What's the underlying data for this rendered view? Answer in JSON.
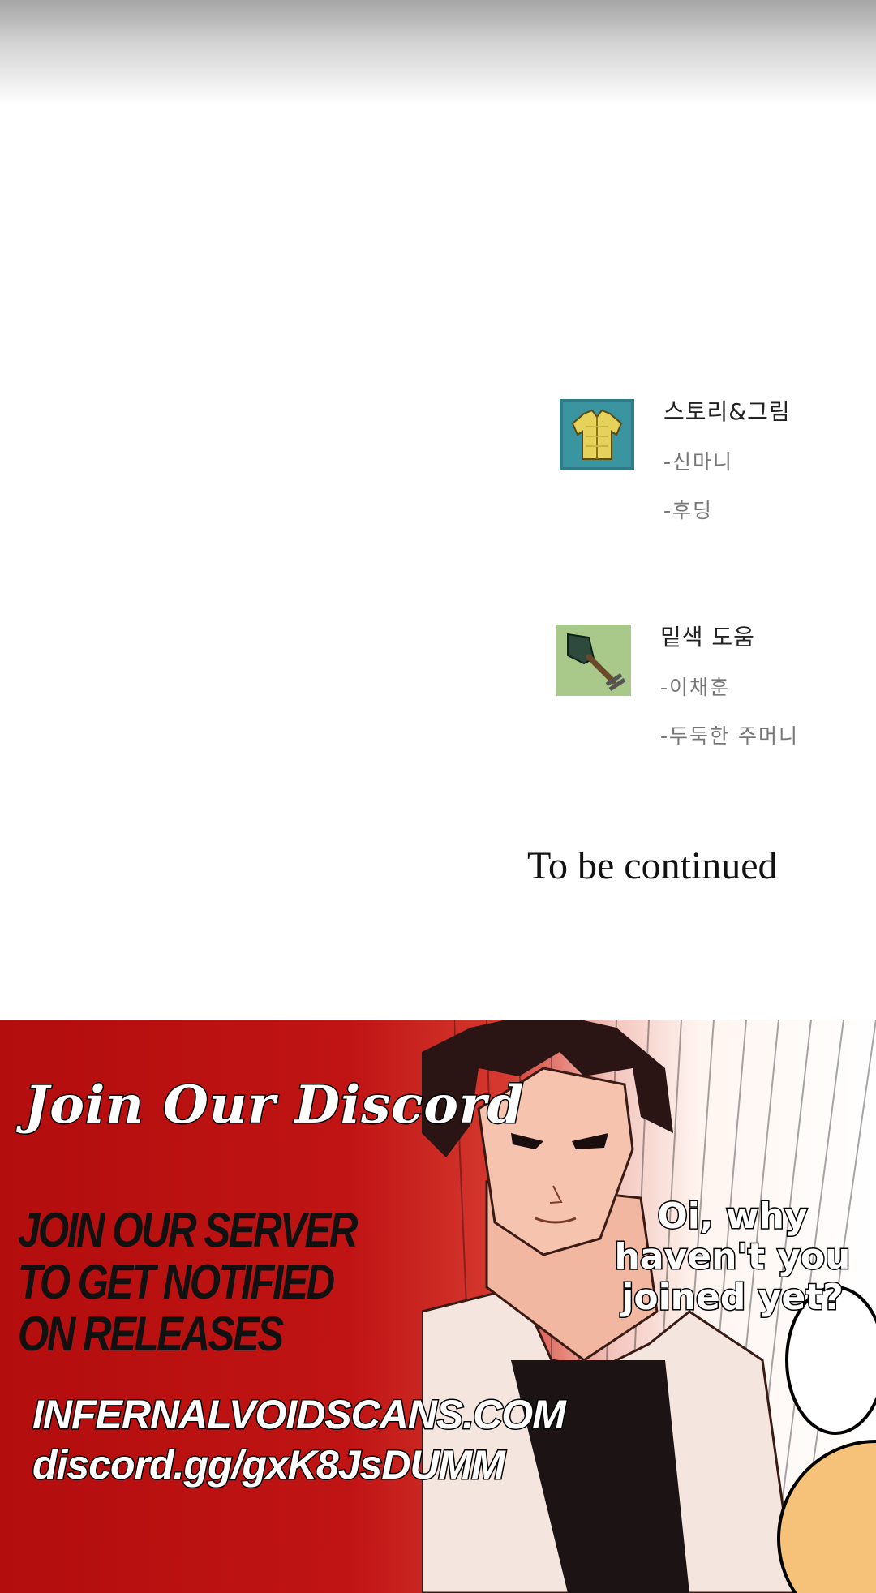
{
  "credits": [
    {
      "heading": "스토리&그림",
      "names": [
        "-신마니",
        "-후딩"
      ],
      "icon": "jacket-icon"
    },
    {
      "heading": "밑색 도움",
      "names": [
        "-이채훈",
        "-두둑한 주머니"
      ],
      "icon": "shovel-icon"
    }
  ],
  "ending_text": "To be continued",
  "banner": {
    "title": "Join Our Discord",
    "subtitle": "JOIN OUR SERVER TO GET NOTIFIED ON RELEASES",
    "site": "INFERNALVOIDSCANS.COM",
    "discord": "discord.gg/gxK8JsDUMM",
    "speech": "Oi, why haven't you joined yet?"
  },
  "colors": {
    "banner_red": "#c01414",
    "tile_teal": "#2f7b86",
    "tile_green": "#a9c98a"
  }
}
